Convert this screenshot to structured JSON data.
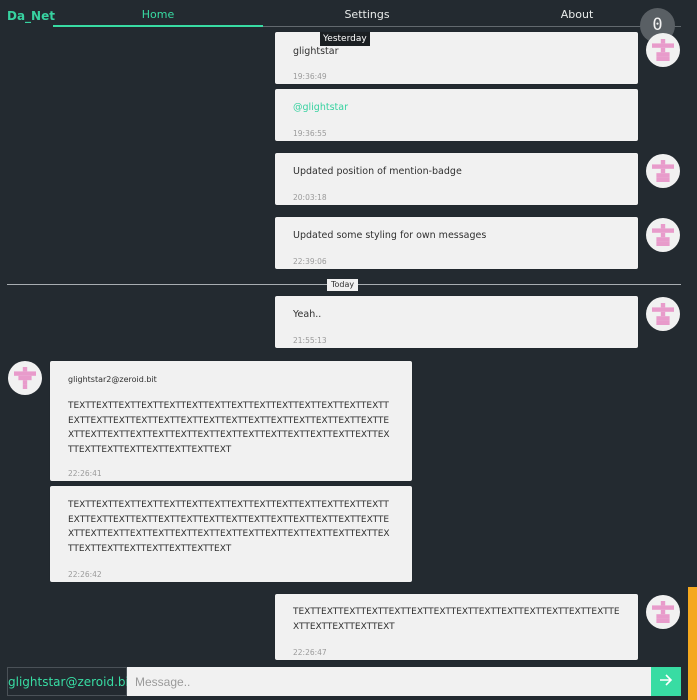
{
  "app": {
    "brand": "Da_Net"
  },
  "nav": {
    "home": "Home",
    "settings": "Settings",
    "about": "About"
  },
  "mention_badge": "0",
  "separators": {
    "yesterday": "Yesterday",
    "today": "Today"
  },
  "messages": [
    {
      "text": "glightstar",
      "time": "19:36:49"
    },
    {
      "text": "@glightstar",
      "time": "19:36:55"
    },
    {
      "text": "Updated position of mention-badge",
      "time": "20:03:18"
    },
    {
      "text": "Updated some styling for own messages",
      "time": "22:39:06"
    },
    {
      "text": "Yeah..",
      "time": "21:55:13"
    },
    {
      "sender": "glightstar2@zeroid.bit",
      "text": "TEXTTEXTTEXTTEXTTEXTTEXTTEXTTEXTTEXTTEXTTEXTTEXTTEXTTEXTTEXTTEXTTEXTTEXTTEXTTEXTTEXTTEXTTEXTTEXTTEXTTEXTTEXTTEXTTEXTTEXTTEXTTEXTTEXTTEXTTEXTTEXTTEXTTEXTTEXTTEXTTEXTTEXTTEXTTEXTTEXTTEXTTEXTTEXTTEXTTEXT",
      "time": "22:26:41"
    },
    {
      "text": "TEXTTEXTTEXTTEXTTEXTTEXTTEXTTEXTTEXTTEXTTEXTTEXTTEXTTEXTTEXTTEXTTEXTTEXTTEXTTEXTTEXTTEXTTEXTTEXTTEXTTEXTTEXTTEXTTEXTTEXTTEXTTEXTTEXTTEXTTEXTTEXTTEXTTEXTTEXTTEXTTEXTTEXTTEXTTEXTTEXTTEXTTEXTTEXTTEXTTEXT",
      "time": "22:26:42"
    },
    {
      "text": "TEXTTEXTTEXTTEXTTEXTTEXTTEXTTEXTTEXTTEXTTEXTTEXTTEXTTEXTTEXTTEXTTEXTTEXTTEXT",
      "time": "22:26:47"
    }
  ],
  "composer": {
    "user": "glightstar@zeroid.bit",
    "placeholder": "Message.."
  },
  "colors": {
    "accent": "#38dca3",
    "background": "#232a30",
    "scrollbar": "#f5a81e"
  }
}
